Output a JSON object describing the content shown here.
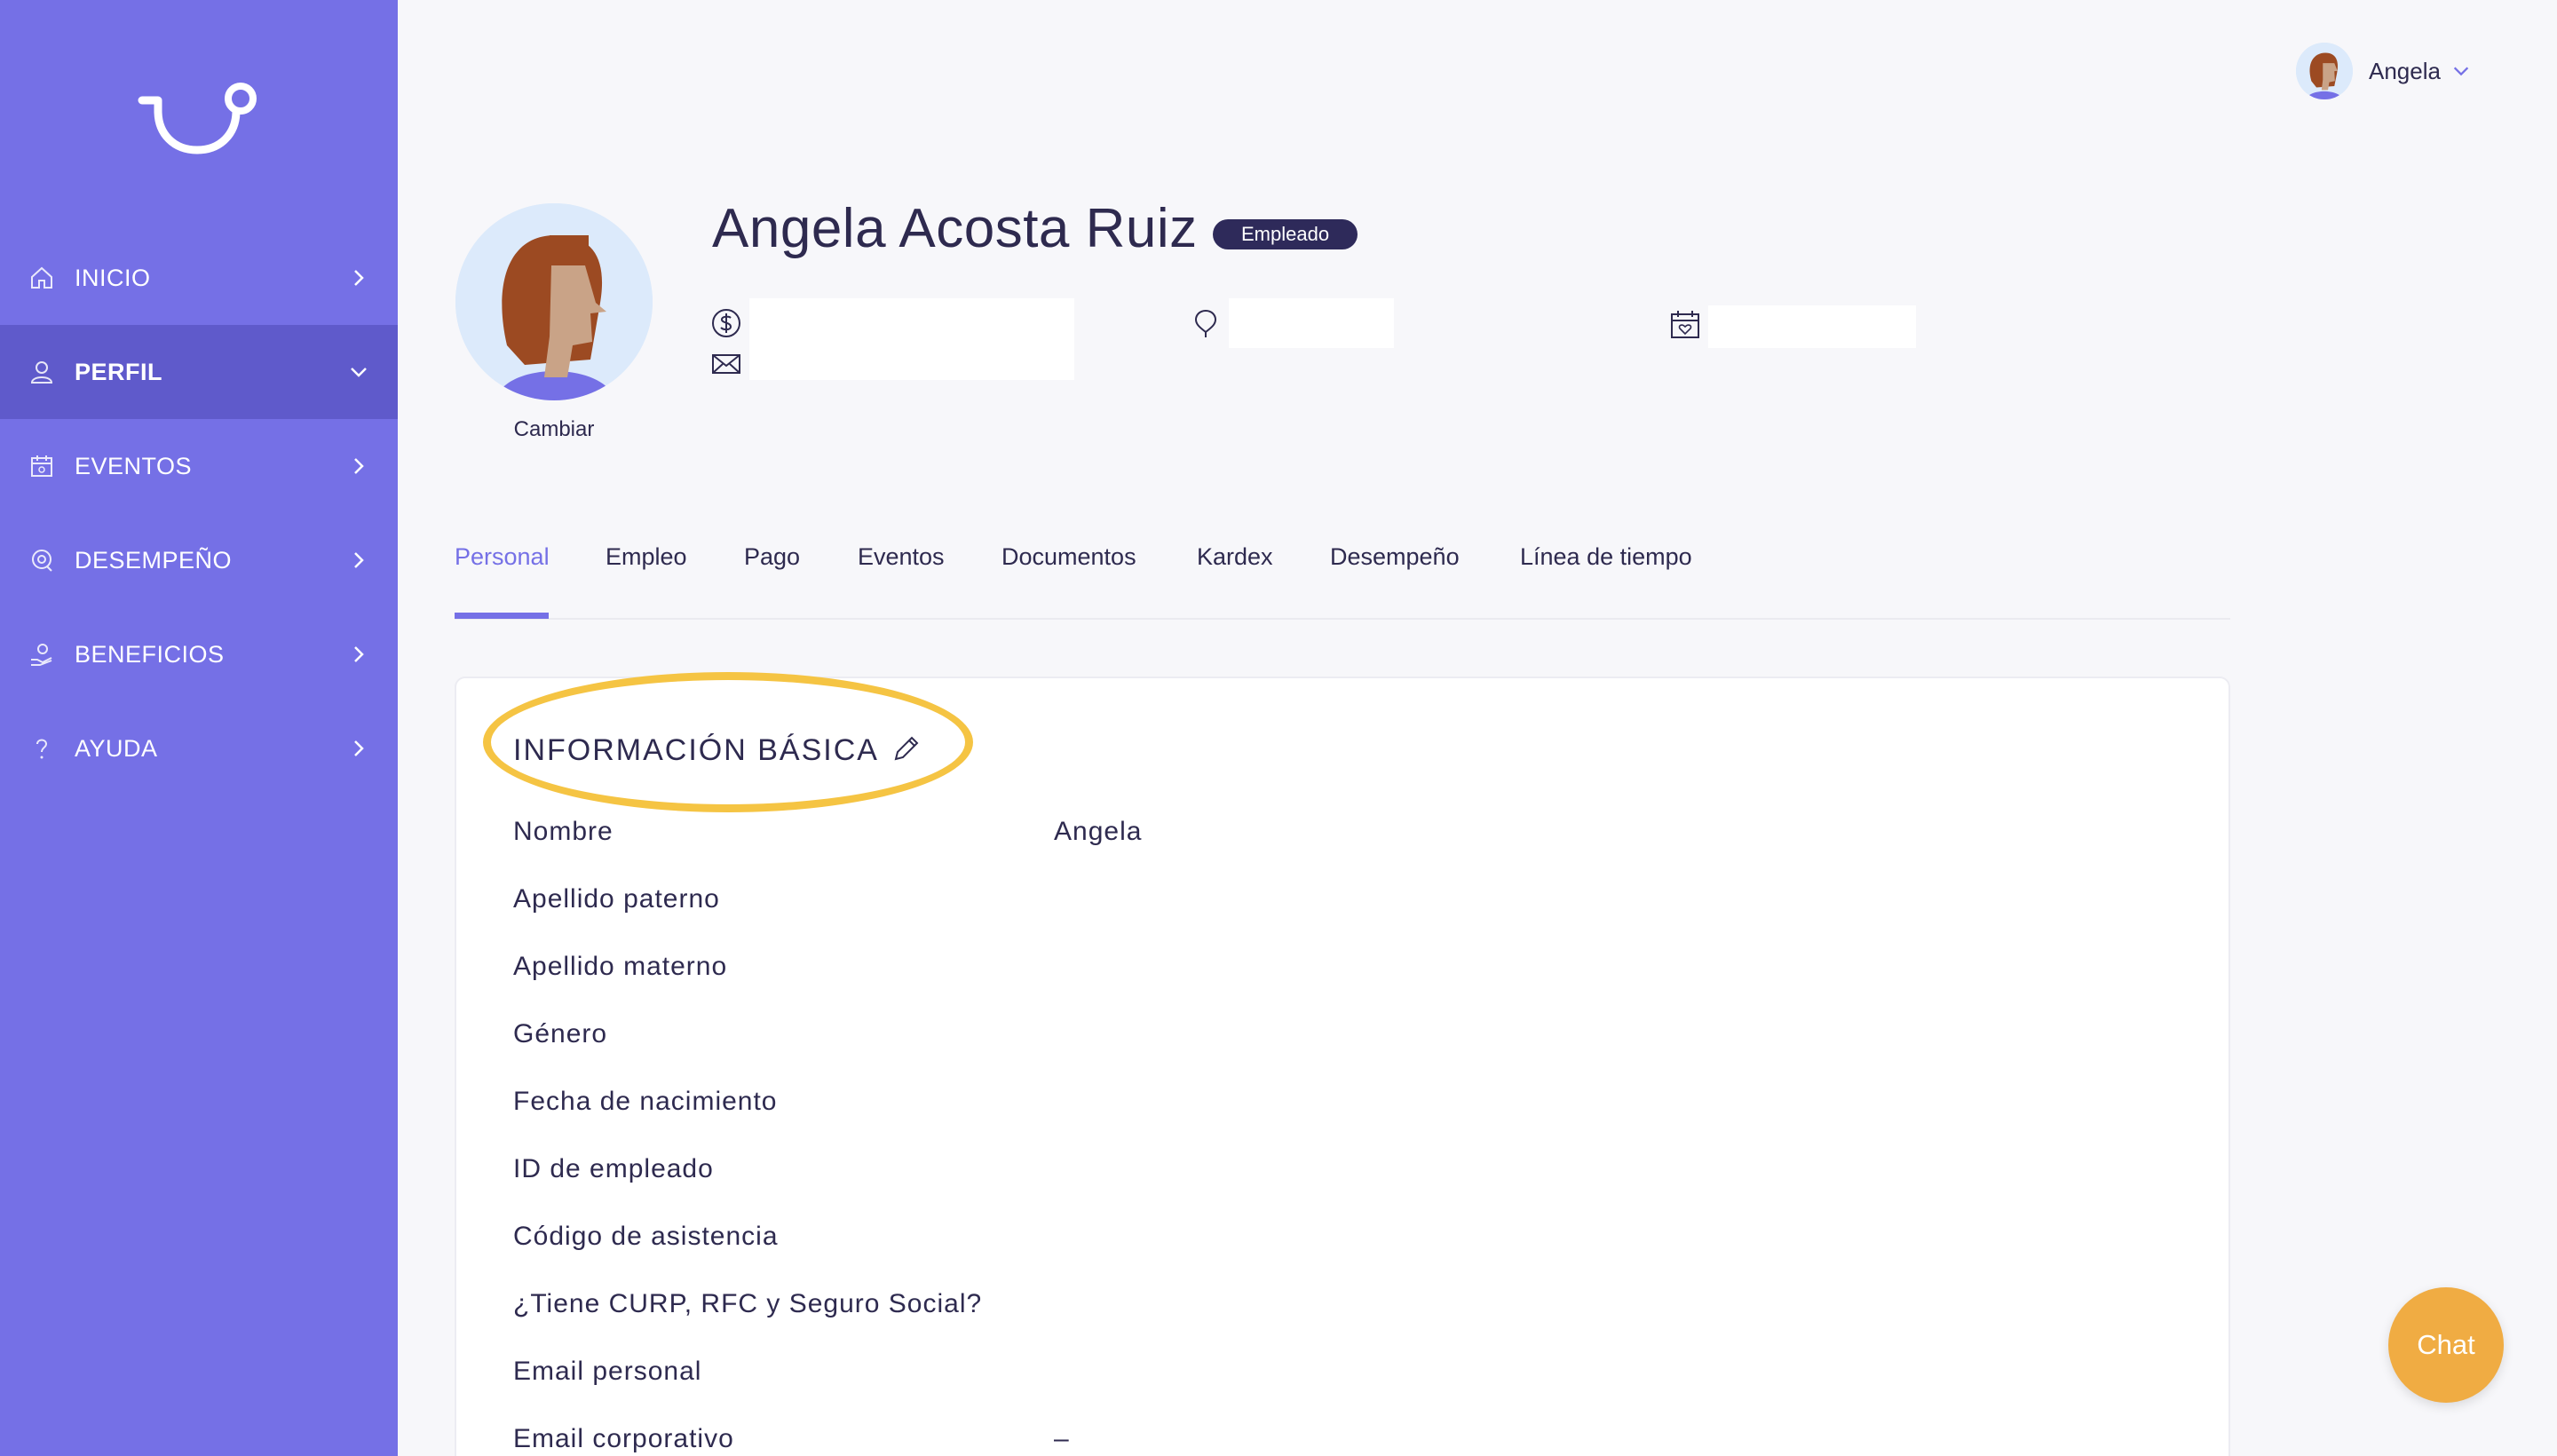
{
  "sidebar": {
    "logo_icon": "smile-hook-logo",
    "items": [
      {
        "label": "INICIO",
        "icon": "home-icon",
        "active": false
      },
      {
        "label": "PERFIL",
        "icon": "user-icon",
        "active": true
      },
      {
        "label": "EVENTOS",
        "icon": "calendar-icon",
        "active": false
      },
      {
        "label": "DESEMPEÑO",
        "icon": "target-icon",
        "active": false
      },
      {
        "label": "BENEFICIOS",
        "icon": "benefits-icon",
        "active": false
      },
      {
        "label": "AYUDA",
        "icon": "help-icon",
        "active": false
      }
    ],
    "color": "#7570e6",
    "active_color": "#5f5acb"
  },
  "header": {
    "user_name": "Angela"
  },
  "profile": {
    "full_name": "Angela Acosta Ruiz",
    "badge": "Empleado",
    "change_photo": "Cambiar",
    "icons": [
      "dollar-icon",
      "mail-icon",
      "location-pin-icon",
      "calendar-heart-icon"
    ]
  },
  "tabs": [
    {
      "label": "Personal",
      "active": true
    },
    {
      "label": "Empleo"
    },
    {
      "label": "Pago"
    },
    {
      "label": "Eventos"
    },
    {
      "label": "Documentos"
    },
    {
      "label": "Kardex"
    },
    {
      "label": "Desempeño"
    },
    {
      "label": "Línea de tiempo"
    }
  ],
  "basic_info": {
    "title": "INFORMACIÓN BÁSICA",
    "fields": [
      {
        "label": "Nombre",
        "value": "Angela"
      },
      {
        "label": "Apellido paterno",
        "value": ""
      },
      {
        "label": "Apellido materno",
        "value": ""
      },
      {
        "label": "Género",
        "value": ""
      },
      {
        "label": "Fecha de nacimiento",
        "value": ""
      },
      {
        "label": "ID de empleado",
        "value": ""
      },
      {
        "label": "Código de asistencia",
        "value": ""
      },
      {
        "label": "¿Tiene CURP, RFC y Seguro Social?",
        "value": ""
      },
      {
        "label": "Email personal",
        "value": ""
      },
      {
        "label": "Email corporativo",
        "value": "–"
      }
    ]
  },
  "chat": {
    "label": "Chat",
    "color": "#f0ac43"
  },
  "highlight_color": "#f5c443",
  "accent": "#7570e6"
}
